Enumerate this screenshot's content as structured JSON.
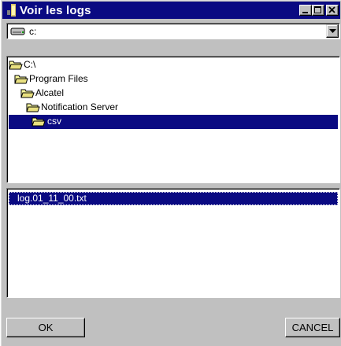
{
  "window": {
    "title": "Voir les logs"
  },
  "drive_combo": {
    "value": "c:"
  },
  "directories": [
    {
      "label": "C:\\",
      "state": "open"
    },
    {
      "label": "Program Files",
      "state": "open"
    },
    {
      "label": "Alcatel",
      "state": "open"
    },
    {
      "label": "Notification Server",
      "state": "open"
    },
    {
      "label": "csv",
      "state": "open",
      "selected": true
    }
  ],
  "files": [
    {
      "label": "log.01_11_00.txt",
      "selected": true
    }
  ],
  "buttons": {
    "ok_label": "OK",
    "cancel_label": "CANCEL"
  },
  "colors": {
    "titlebar": "#0a0a82",
    "selection": "#0a0a82",
    "face": "#c0c0c0",
    "folder": "#ffff9e"
  },
  "icons": {
    "title": "app-icon",
    "drive": "hard-drive-icon",
    "folder": "open-folder-icon",
    "minimize": "minimize-icon",
    "maximize": "maximize-icon",
    "close": "close-icon",
    "dropdown": "chevron-down-icon"
  }
}
